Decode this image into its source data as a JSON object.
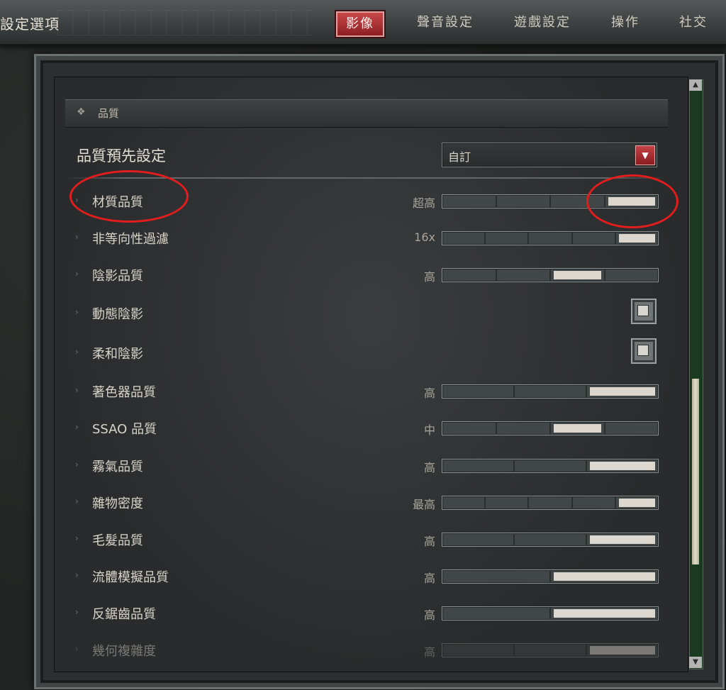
{
  "header": {
    "title": "設定選項",
    "tabs": [
      {
        "label": "影像",
        "active": true
      },
      {
        "label": "聲音設定",
        "active": false
      },
      {
        "label": "遊戲設定",
        "active": false
      },
      {
        "label": "操作",
        "active": false
      },
      {
        "label": "社交",
        "active": false
      }
    ]
  },
  "section": {
    "title": "品質",
    "icon": "diamond-ornament-icon"
  },
  "preset": {
    "label": "品質預先設定",
    "value": "自訂",
    "icon": "dropdown-arrow-icon"
  },
  "settings": [
    {
      "label": "材質品質",
      "value": "超高",
      "segments": 4,
      "filled": 3
    },
    {
      "label": "非等向性過濾",
      "value": "16x",
      "segments": 5,
      "filled": 4
    },
    {
      "label": "陰影品質",
      "value": "高",
      "segments": 4,
      "filled": 2
    },
    {
      "label": "動態陰影",
      "type": "checkbox",
      "checked": false
    },
    {
      "label": "柔和陰影",
      "type": "checkbox",
      "checked": false
    },
    {
      "label": "著色器品質",
      "value": "高",
      "segments": 3,
      "filled": 2
    },
    {
      "label": "SSAO 品質",
      "value": "中",
      "segments": 4,
      "filled": 2
    },
    {
      "label": "霧氣品質",
      "value": "高",
      "segments": 3,
      "filled": 2
    },
    {
      "label": "雜物密度",
      "value": "最高",
      "segments": 5,
      "filled": 4
    },
    {
      "label": "毛髮品質",
      "value": "高",
      "segments": 3,
      "filled": 2
    },
    {
      "label": "流體模擬品質",
      "value": "高",
      "segments": 2,
      "filled": 1
    },
    {
      "label": "反鋸齒品質",
      "value": "高",
      "segments": 2,
      "filled": 1
    },
    {
      "label": "幾何複雜度",
      "value": "高",
      "segments": 3,
      "filled": 2
    }
  ],
  "colors": {
    "accent_red": "#b3282c",
    "annotation_red": "#e31d1d",
    "scrollbar_green": "#1a3a1f"
  }
}
